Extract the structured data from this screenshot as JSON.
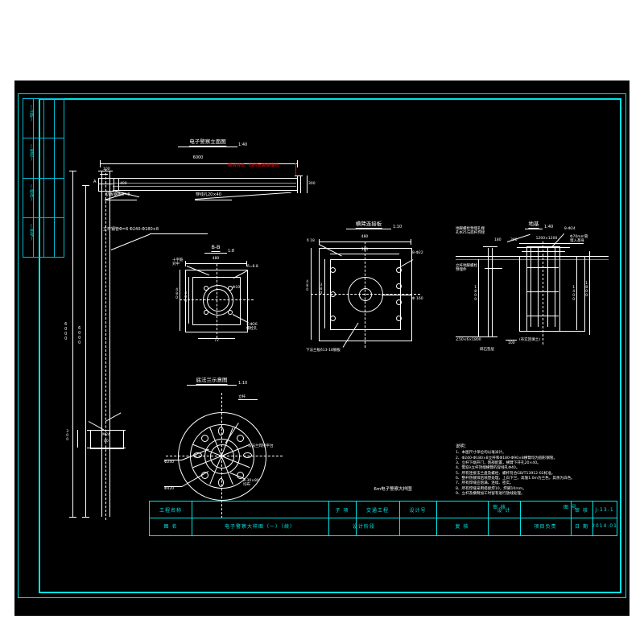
{
  "sheet": {
    "bg": "#ffffff",
    "canvas_bg": "#000000",
    "frame_color": "#00e5e5",
    "line_color": "#ffffff",
    "highlight_color": "#ff0000"
  },
  "revision_table": {
    "labels": [
      "(日期)",
      "(签名)",
      "(修改)",
      "(序号)"
    ]
  },
  "views": {
    "elevation": {
      "title": "电子警察立面图",
      "scale": "1:40",
      "dims": {
        "span": "6000",
        "arm_drop": "400",
        "arm_top": "100",
        "end_height": "300",
        "pole_height": "6000",
        "pole_total": "6000",
        "base_w": "300"
      },
      "labels": {
        "red_note": "横臂挂8，同时安装摄像机",
        "gusset": "肋板钢板δ=8",
        "hole": "穿线孔20×40",
        "pole_spec": "立杆钢管Φ=6 Φ240-Φ180×8",
        "section_a": "A",
        "section_b": "B"
      }
    },
    "section_bb": {
      "title": "B-B",
      "scale": "1:8",
      "labels": {
        "top_left": "十字筋\n对中",
        "width": "480",
        "inner_w": "400",
        "height": "480",
        "inner_h": "400",
        "thick": "δ=8.8",
        "bolt": "Φ10",
        "bottom": "72",
        "hole_note": "4-Φ26\n螺栓孔"
      }
    },
    "arm_plate": {
      "title": "横臂连接板",
      "scale": "1:10",
      "labels": {
        "thick": "δ 18",
        "width": "480",
        "inner_w": "380",
        "height": "480",
        "inner_h": "380",
        "bolts": "8-Φ22",
        "hole": "Φ 160",
        "bottom_note": "下法兰板δ13-18钢板"
      }
    },
    "foundation": {
      "title": "地基",
      "scale": "1:40",
      "labels": {
        "anchor_note": "地脚螺栓预埋孔端\n孔Φ25与底杆焊接",
        "pole_note": "立杆地脚螺栓\n预埋件",
        "plate_size": "1200×1200",
        "rebar": "8-Φ24",
        "conduit": "Φ70mm管\n埋入基身",
        "d1": "180",
        "d2": "300",
        "d3": "100",
        "depth": "1800",
        "depth2": "1400",
        "depth3": "1800",
        "angle": "∠50×6×1800",
        "ground": "(夯实回填土)",
        "foot": "碎石垫层"
      }
    },
    "flange": {
      "title": "底法兰示意图",
      "scale": "1:10",
      "labels": {
        "post": "立杆",
        "platform": "与法兰焊接平台",
        "d240": "Φ240",
        "d420": "Φ420",
        "bolts": "8-30×80\n均布"
      }
    },
    "bottom_caption": "6m电子警察大样图"
  },
  "notes": {
    "heading": "说明：",
    "lines": [
      "1、本图尺寸单位均以毫米计。",
      "2、Φ240-Φ180×8立杆和Φ180-Φ90×8横臂均为圆形钢管。",
      "3、立杆下端开门，割部配置，横臂下开孔20×40。",
      "4、需穿λ立杆顶端横臂的穿线孔Φ40。",
      "5、所有连接法兰盘及螺栓、螺杆符合GB/T13912-02标准。",
      "6、整杆热镀锌后喷塑处理，上白下兰，高施1.0m为兰色，其余为白色。",
      "7、所有焊缝应饱满、连续、密实。",
      "8、所有焊缝采用搭接焊10，焊脚10mm。",
      "9、立杆及横臂加工时留有进行放线处理。"
    ]
  },
  "title_block": {
    "row1": [
      {
        "label": "工程名称",
        "value": ""
      },
      {
        "label": "子 项",
        "value": "交通工程"
      },
      {
        "label": "设计号",
        "value": ""
      },
      {
        "label": "设 计",
        "value": ""
      },
      {
        "label": "审 核",
        "value": ""
      },
      {
        "label": "图 号",
        "value": "J-13-1"
      }
    ],
    "row2": [
      {
        "label": "图 名",
        "value": "电子警察大样图（一）（续）"
      },
      {
        "label": "设计阶段",
        "value": ""
      },
      {
        "label": "复 核",
        "value": ""
      },
      {
        "label": "项目负责",
        "value": ""
      },
      {
        "label": "日 期",
        "value": "2014.01"
      }
    ]
  }
}
